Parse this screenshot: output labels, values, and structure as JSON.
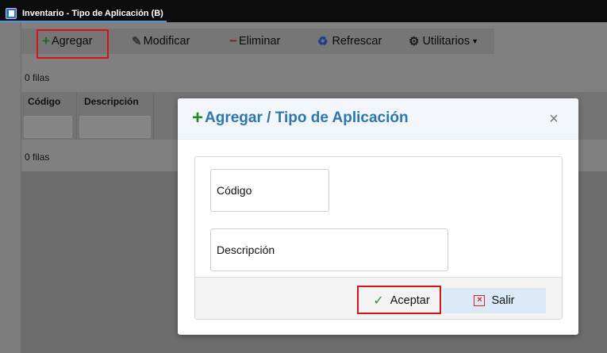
{
  "window": {
    "title": "Inventario - Tipo de Aplicación (B)"
  },
  "toolbar": {
    "add_label": "Agregar",
    "edit_label": "Modificar",
    "delete_label": "Eliminar",
    "refresh_label": "Refrescar",
    "utils_label": "Utilitarios"
  },
  "grid": {
    "row_count_top": "0 filas",
    "row_count_bottom": "0 filas",
    "columns": [
      "Código",
      "Descripción"
    ]
  },
  "modal": {
    "title": "Agregar / Tipo de Aplicación",
    "fields": {
      "code_placeholder": "Código",
      "description_placeholder": "Descripción"
    },
    "accept_label": "Aceptar",
    "exit_label": "Salir"
  },
  "colors": {
    "accent_blue": "#2c77ad",
    "add_green": "#1e8a24",
    "highlight_red": "#d8141b"
  }
}
